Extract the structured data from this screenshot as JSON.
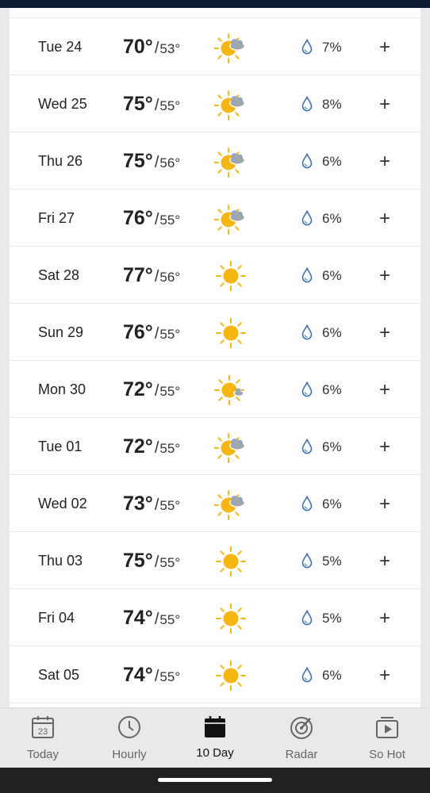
{
  "forecast": [
    {
      "day": "Tue 24",
      "high": "70°",
      "low": "53°",
      "precip": "7%",
      "icon": "partly-cloudy-icon"
    },
    {
      "day": "Wed 25",
      "high": "75°",
      "low": "55°",
      "precip": "8%",
      "icon": "partly-cloudy-icon"
    },
    {
      "day": "Thu 26",
      "high": "75°",
      "low": "56°",
      "precip": "6%",
      "icon": "partly-cloudy-icon"
    },
    {
      "day": "Fri 27",
      "high": "76°",
      "low": "55°",
      "precip": "6%",
      "icon": "partly-cloudy-icon"
    },
    {
      "day": "Sat 28",
      "high": "77°",
      "low": "56°",
      "precip": "6%",
      "icon": "sunny-icon"
    },
    {
      "day": "Sun 29",
      "high": "76°",
      "low": "55°",
      "precip": "6%",
      "icon": "sunny-icon"
    },
    {
      "day": "Mon 30",
      "high": "72°",
      "low": "55°",
      "precip": "6%",
      "icon": "mostly-sunny-icon"
    },
    {
      "day": "Tue 01",
      "high": "72°",
      "low": "55°",
      "precip": "6%",
      "icon": "partly-cloudy-icon"
    },
    {
      "day": "Wed 02",
      "high": "73°",
      "low": "55°",
      "precip": "6%",
      "icon": "partly-cloudy-icon"
    },
    {
      "day": "Thu 03",
      "high": "75°",
      "low": "55°",
      "precip": "5%",
      "icon": "sunny-icon"
    },
    {
      "day": "Fri 04",
      "high": "74°",
      "low": "55°",
      "precip": "5%",
      "icon": "sunny-icon"
    },
    {
      "day": "Sat 05",
      "high": "74°",
      "low": "55°",
      "precip": "6%",
      "icon": "sunny-icon"
    }
  ],
  "temp_separator": "/",
  "expand_symbol": "+",
  "nav": {
    "items": [
      {
        "label": "Today",
        "icon": "calendar-day-icon",
        "badge": "23"
      },
      {
        "label": "Hourly",
        "icon": "clock-icon"
      },
      {
        "label": "10 Day",
        "icon": "calendar-icon"
      },
      {
        "label": "Radar",
        "icon": "radar-icon"
      },
      {
        "label": "So Hot",
        "icon": "video-icon"
      }
    ],
    "active": "10 Day"
  },
  "colors": {
    "sun": "#F7B512",
    "cloud": "#9BA7B3",
    "drop": "#3A6FB7",
    "header": "#0C1A33",
    "nav_active": "#111111",
    "nav_inactive": "#666666"
  }
}
